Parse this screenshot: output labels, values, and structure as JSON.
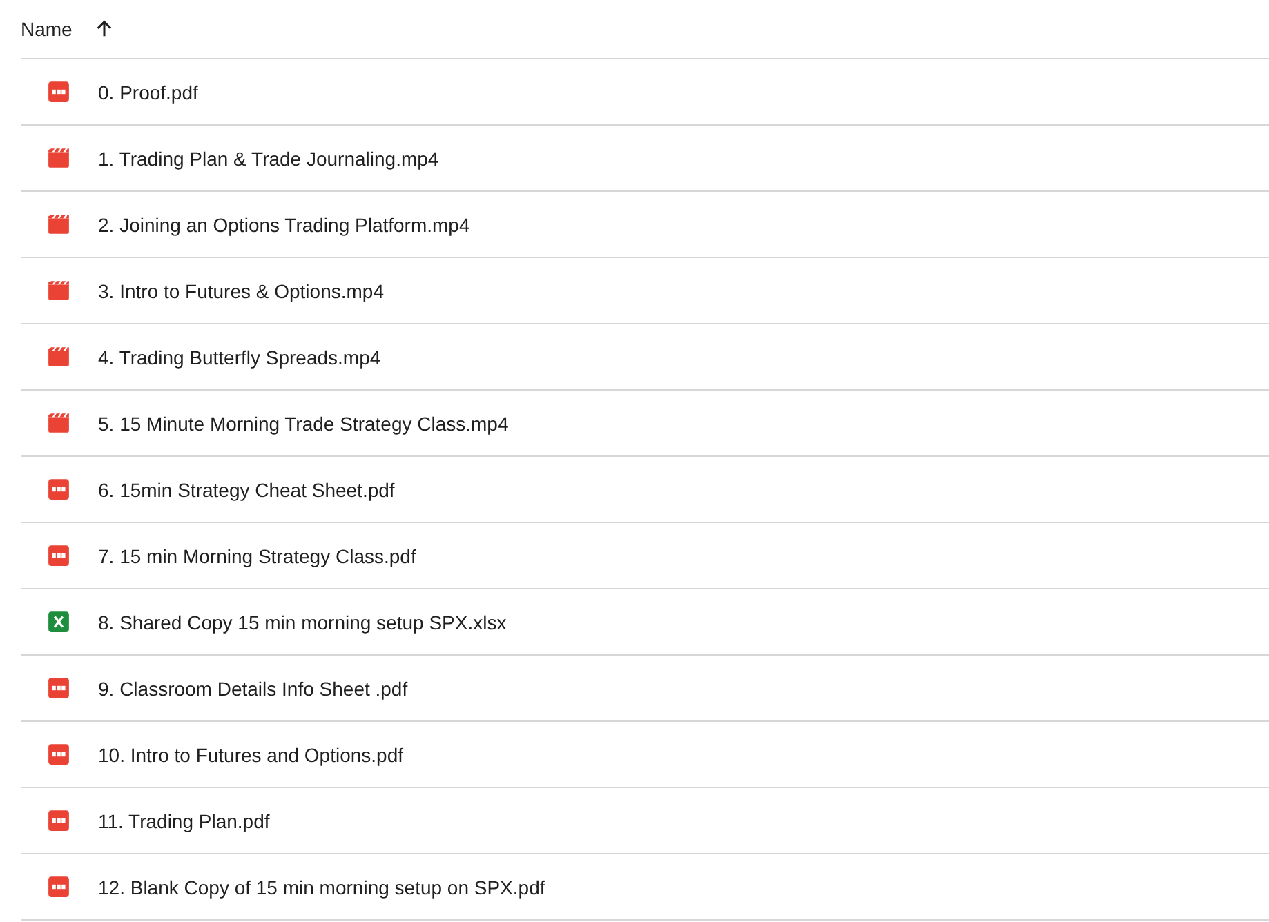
{
  "header": {
    "label": "Name",
    "sort_ascending": true
  },
  "files": [
    {
      "kind": "pdf",
      "name": "0. Proof.pdf"
    },
    {
      "kind": "video",
      "name": "1. Trading Plan & Trade Journaling.mp4"
    },
    {
      "kind": "video",
      "name": "2. Joining an Options Trading Platform.mp4"
    },
    {
      "kind": "video",
      "name": "3. Intro to Futures & Options.mp4"
    },
    {
      "kind": "video",
      "name": "4. Trading Butterfly Spreads.mp4"
    },
    {
      "kind": "video",
      "name": "5. 15 Minute Morning Trade Strategy Class.mp4"
    },
    {
      "kind": "pdf",
      "name": "6. 15min Strategy Cheat Sheet.pdf"
    },
    {
      "kind": "pdf",
      "name": "7. 15 min Morning Strategy Class.pdf"
    },
    {
      "kind": "spreadsheet",
      "name": "8. Shared Copy 15 min morning setup SPX.xlsx"
    },
    {
      "kind": "pdf",
      "name": "9. Classroom Details Info Sheet .pdf"
    },
    {
      "kind": "pdf",
      "name": "10. Intro to Futures and Options.pdf"
    },
    {
      "kind": "pdf",
      "name": "11. Trading Plan.pdf"
    },
    {
      "kind": "pdf",
      "name": "12. Blank Copy of 15 min morning setup on SPX.pdf"
    }
  ]
}
